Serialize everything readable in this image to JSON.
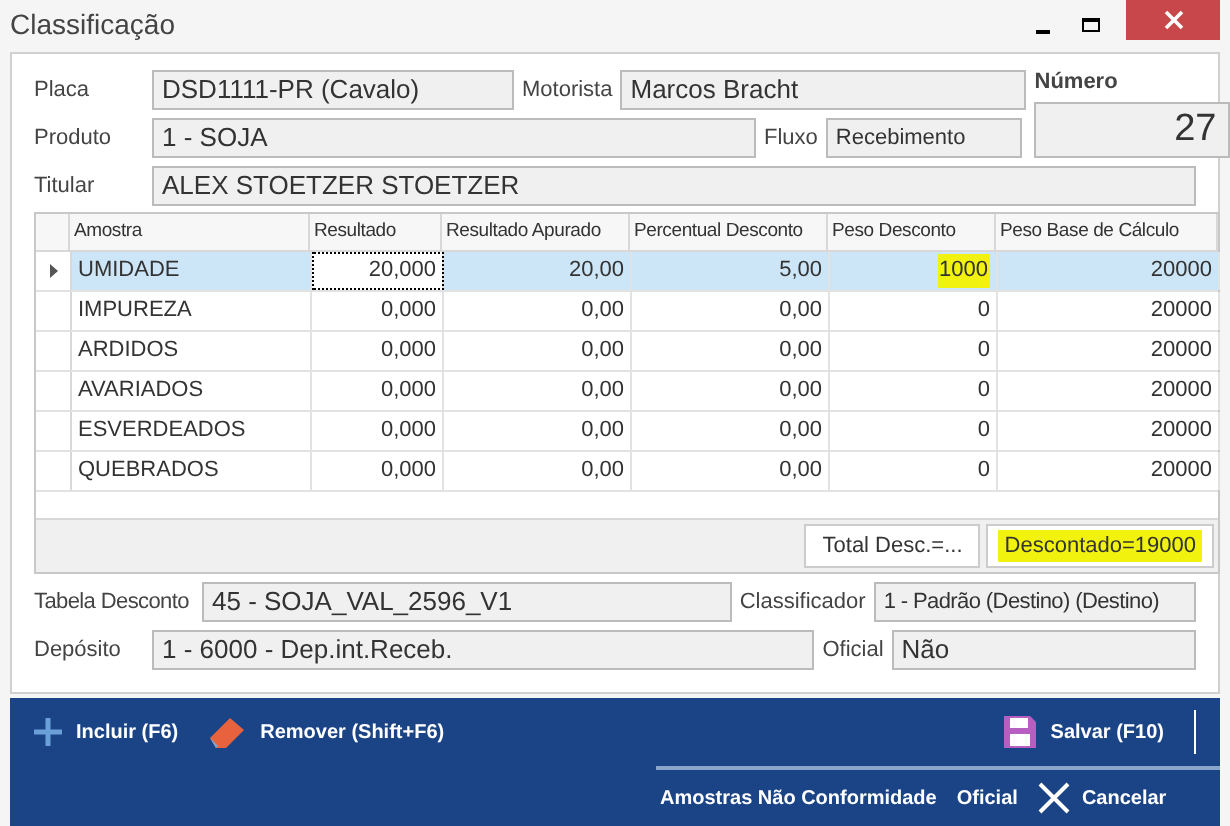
{
  "window": {
    "title": "Classificação"
  },
  "form": {
    "placa": {
      "label": "Placa",
      "value": "DSD1111-PR (Cavalo)"
    },
    "motorista": {
      "label": "Motorista",
      "value": "Marcos Bracht"
    },
    "numero": {
      "label": "Número",
      "value": "27"
    },
    "produto": {
      "label": "Produto",
      "value": "1 - SOJA"
    },
    "fluxo": {
      "label": "Fluxo",
      "value": "Recebimento"
    },
    "titular": {
      "label": "Titular",
      "value": "ALEX STOETZER STOETZER"
    },
    "tabela_desconto": {
      "label": "Tabela Desconto",
      "value": "45 - SOJA_VAL_2596_V1"
    },
    "classificador": {
      "label": "Classificador",
      "value": "1 - Padrão (Destino) (Destino)"
    },
    "deposito": {
      "label": "Depósito",
      "value": "1 - 6000 - Dep.int.Receb."
    },
    "oficial": {
      "label": "Oficial",
      "value": "Não"
    }
  },
  "table": {
    "columns": [
      "Amostra",
      "Resultado",
      "Resultado Apurado",
      "Percentual Desconto",
      "Peso Desconto",
      "Peso Base de Cálculo"
    ],
    "rows": [
      {
        "selected": true,
        "cells": [
          "UMIDADE",
          {
            "text": "20,000",
            "focused": true
          },
          "20,00",
          "5,00",
          {
            "text": "1000",
            "highlighted": true
          },
          "20000"
        ]
      },
      {
        "selected": false,
        "cells": [
          "IMPUREZA",
          "0,000",
          "0,00",
          "0,00",
          "0",
          "20000"
        ]
      },
      {
        "selected": false,
        "cells": [
          "ARDIDOS",
          "0,000",
          "0,00",
          "0,00",
          "0",
          "20000"
        ]
      },
      {
        "selected": false,
        "cells": [
          "AVARIADOS",
          "0,000",
          "0,00",
          "0,00",
          "0",
          "20000"
        ]
      },
      {
        "selected": false,
        "cells": [
          "ESVERDEADOS",
          "0,000",
          "0,00",
          "0,00",
          "0",
          "20000"
        ]
      },
      {
        "selected": false,
        "cells": [
          "QUEBRADOS",
          "0,000",
          "0,00",
          "0,00",
          "0",
          "20000"
        ]
      }
    ],
    "footer": [
      {
        "text": "Total Desc.=...",
        "highlighted": false
      },
      {
        "text": "Descontado=19000",
        "highlighted": true
      }
    ]
  },
  "toolbar": {
    "top": [
      {
        "kind": "plus",
        "label": "Incluir (F6)"
      },
      {
        "kind": "eraser",
        "label": "Remover (Shift+F6)"
      },
      {
        "kind": "save",
        "label": "Salvar (F10)"
      }
    ],
    "bottom": [
      {
        "kind": "text",
        "label": "Amostras Não Conformidade"
      },
      {
        "kind": "text",
        "label": "Oficial"
      },
      {
        "kind": "close",
        "label": "Cancelar"
      }
    ]
  }
}
